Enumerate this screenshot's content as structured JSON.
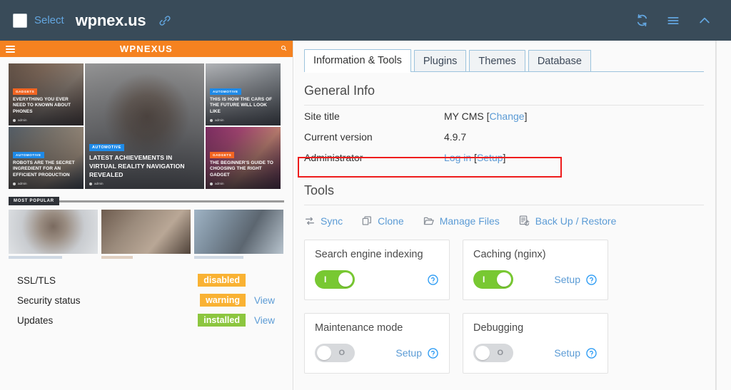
{
  "header": {
    "checkbox_checked": false,
    "select_label": "Select",
    "site_domain": "wpnex.us",
    "link_icon": "link-icon",
    "actions": [
      {
        "name": "refresh-icon",
        "title": "Refresh"
      },
      {
        "name": "menu-icon",
        "title": "Menu"
      },
      {
        "name": "chevron-up-icon",
        "title": "Collapse"
      }
    ],
    "bg_color": "#394b59",
    "accent_link_color": "#63a6e0"
  },
  "preview": {
    "brand": "WPNEXUS",
    "burger_icon": "hamburger-icon",
    "search_icon": "search-icon",
    "brand_bg": "#f58220",
    "articles": [
      {
        "category": "GADGETS",
        "category_color": "orange",
        "title": "EVERYTHING YOU EVER NEED TO KNOWN ABOUT PHONES",
        "author": "admin"
      },
      {
        "category": "AUTOMOTIVE",
        "category_color": "blue",
        "title": "ROBOTS ARE THE SECRET INGREDIENT FOR AN EFFICIENT PRODUCTION",
        "author": "admin"
      },
      {
        "category": "AUTOMOTIVE",
        "category_color": "blue",
        "title": "LATEST ACHIEVEMENTS IN VIRTUAL REALITY NAVIGATION REVEALED",
        "author": "admin"
      },
      {
        "category": "AUTOMOTIVE",
        "category_color": "blue",
        "title": "THIS IS HOW THE CARS OF THE FUTURE WILL LOOK LIKE",
        "author": "admin"
      },
      {
        "category": "GADGETS",
        "category_color": "orange",
        "title": "THE BEGINNER'S GUIDE TO CHOOSING THE RIGHT GADGET",
        "author": "admin"
      }
    ],
    "most_popular_label": "MOST POPULAR",
    "most_popular_count": 3
  },
  "status_rows": [
    {
      "label": "SSL/TLS",
      "badge": "disabled",
      "badge_type": "warn",
      "action": ""
    },
    {
      "label": "Security status",
      "badge": "warning",
      "badge_type": "warn",
      "action": "View"
    },
    {
      "label": "Updates",
      "badge": "installed",
      "badge_type": "ok",
      "action": "View"
    }
  ],
  "badge_colors": {
    "warn": "#f9b233",
    "ok": "#8cc63f"
  },
  "tabs": [
    {
      "label": "Information & Tools",
      "active": true
    },
    {
      "label": "Plugins",
      "active": false
    },
    {
      "label": "Themes",
      "active": false
    },
    {
      "label": "Database",
      "active": false
    }
  ],
  "general_info": {
    "title": "General Info",
    "rows": [
      {
        "key": "Site title",
        "value": "MY CMS",
        "links": [
          {
            "text": "Change",
            "bracketed": true
          }
        ],
        "highlighted": false
      },
      {
        "key": "Current version",
        "value": "4.9.7",
        "links": [],
        "highlighted": false
      },
      {
        "key": "Administrator",
        "value": "",
        "links": [
          {
            "text": "Log in",
            "bracketed": false
          },
          {
            "text": "Setup",
            "bracketed": true
          }
        ],
        "highlighted": true
      }
    ],
    "highlight_color": "#ee1c1c"
  },
  "tools": {
    "title": "Tools",
    "items": [
      {
        "label": "Sync",
        "icon": "sync-icon"
      },
      {
        "label": "Clone",
        "icon": "clone-icon"
      },
      {
        "label": "Manage Files",
        "icon": "folder-open-icon"
      },
      {
        "label": "Back Up / Restore",
        "icon": "backup-restore-icon"
      }
    ]
  },
  "option_cards": [
    {
      "title": "Search engine indexing",
      "toggle_state": "on",
      "toggle_mark": "I",
      "setup_label": "",
      "help_icon": "help-circle-icon"
    },
    {
      "title": "Caching (nginx)",
      "toggle_state": "on",
      "toggle_mark": "I",
      "setup_label": "Setup",
      "help_icon": "help-circle-icon"
    },
    {
      "title": "Maintenance mode",
      "toggle_state": "off",
      "toggle_mark": "O",
      "setup_label": "Setup",
      "help_icon": "help-circle-icon"
    },
    {
      "title": "Debugging",
      "toggle_state": "off",
      "toggle_mark": "O",
      "setup_label": "Setup",
      "help_icon": "help-circle-icon"
    }
  ],
  "colors": {
    "link_blue": "#5b9bd5",
    "toggle_on": "#78c832",
    "toggle_off": "#d7d9dc",
    "tab_border": "#9cc3dd"
  }
}
